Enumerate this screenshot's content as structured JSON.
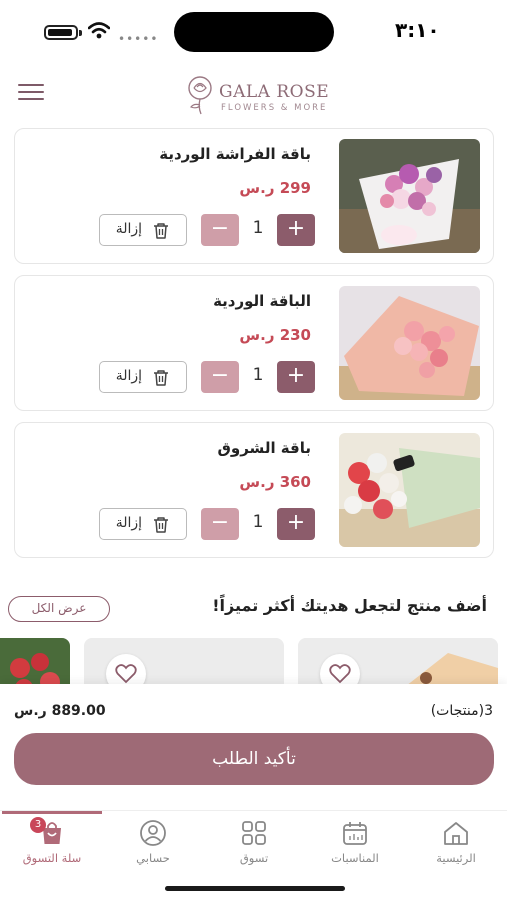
{
  "status_bar": {
    "time": "٣:١٠"
  },
  "header": {
    "brand_name": "GALA ROSE",
    "brand_tagline": "FLOWERS & MORE"
  },
  "cart": {
    "items": [
      {
        "name": "باقة الفراشة الوردية",
        "price": "299 ر.س",
        "quantity": "1",
        "remove_label": "إزالة",
        "plus": "+",
        "minus": "−"
      },
      {
        "name": "الباقة الوردية",
        "price": "230 ر.س",
        "quantity": "1",
        "remove_label": "إزالة",
        "plus": "+",
        "minus": "−"
      },
      {
        "name": "باقة الشروق",
        "price": "360 ر.س",
        "quantity": "1",
        "remove_label": "إزالة",
        "plus": "+",
        "minus": "−"
      }
    ]
  },
  "suggestions": {
    "title": "أضف منتج لتجعل هديتك أكثر تميزاً!",
    "view_all": "عرض الكل"
  },
  "order": {
    "total": "889.00 ر.س",
    "count": "3(منتجات)",
    "confirm_label": "تأكيد الطلب"
  },
  "bottom_nav": {
    "items": [
      {
        "label": "الرئيسية",
        "icon": "home-icon"
      },
      {
        "label": "المناسبات",
        "icon": "calendar-icon"
      },
      {
        "label": "تسوق",
        "icon": "grid-icon"
      },
      {
        "label": "حسابي",
        "icon": "user-icon"
      },
      {
        "label": "سلة التسوق",
        "icon": "cart-bag-icon",
        "badge": "3",
        "active": true
      }
    ]
  },
  "colors": {
    "accent": "#8c5c6b",
    "price": "#c54a56",
    "confirm_button": "#9e6a76",
    "active_nav": "#b06a78"
  }
}
